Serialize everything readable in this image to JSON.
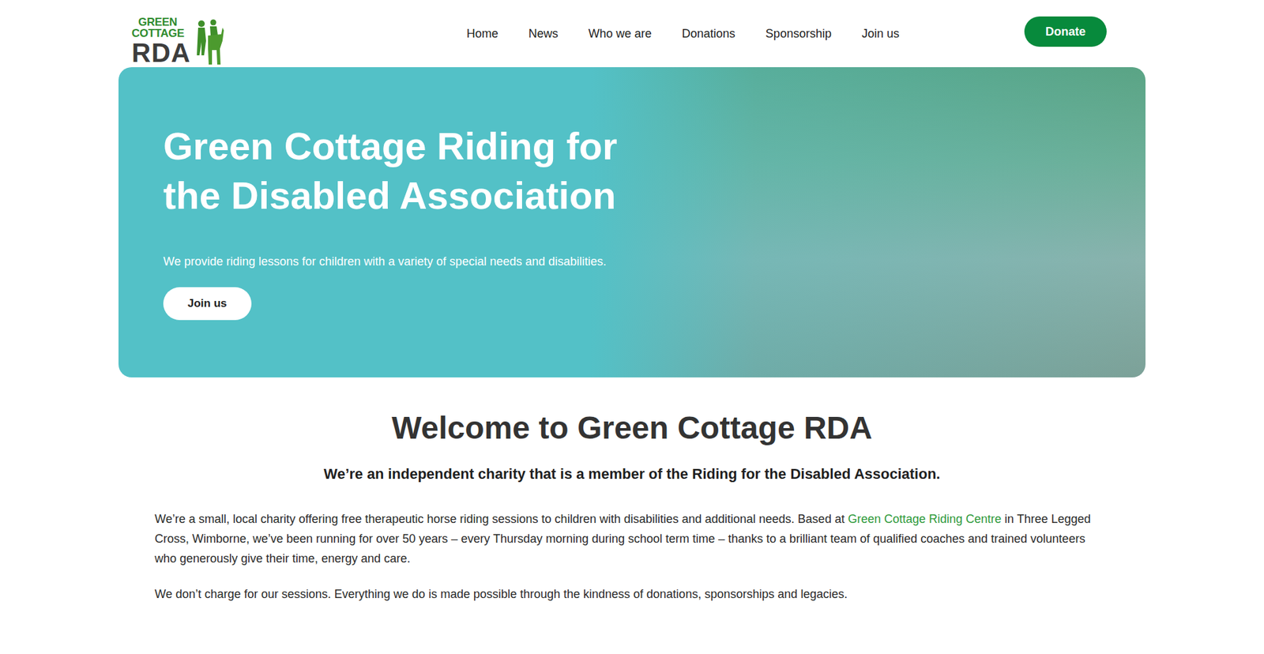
{
  "header": {
    "logo": {
      "lines": [
        "GREEN",
        "COTTAGE",
        "RDA"
      ]
    },
    "nav": [
      "Home",
      "News",
      "Who we are",
      "Donations",
      "Sponsorship",
      "Join us"
    ],
    "donate": "Donate"
  },
  "hero": {
    "title": "Green Cottage Riding for the Disabled Association",
    "subtitle": "We provide riding lessons for children with a variety of special needs and disabilities.",
    "button": "Join us"
  },
  "intro": {
    "title": "Welcome to Green Cottage RDA",
    "subtitle": "We’re an independent charity that is a member of the Riding for the Disabled Association.",
    "paragraphs": [
      [
        {
          "text": "We’re a small, local charity offering free therapeutic horse riding sessions to children with disabilities and additional needs. Based at ",
          "link": false
        },
        {
          "text": "Green Cottage Riding Centre",
          "link": true
        },
        {
          "text": " in Three Legged Cross, Wimborne, we’ve been running for over 50 years – every Thursday morning during school term time – thanks to a brilliant team of qualified coaches and trained volunteers who generously give their time, energy and care.",
          "link": false
        }
      ],
      [
        {
          "text": "We don’t charge for our sessions. Everything we do is made possible through the kindness of donations, sponsorships and legacies.",
          "link": false
        }
      ]
    ]
  }
}
